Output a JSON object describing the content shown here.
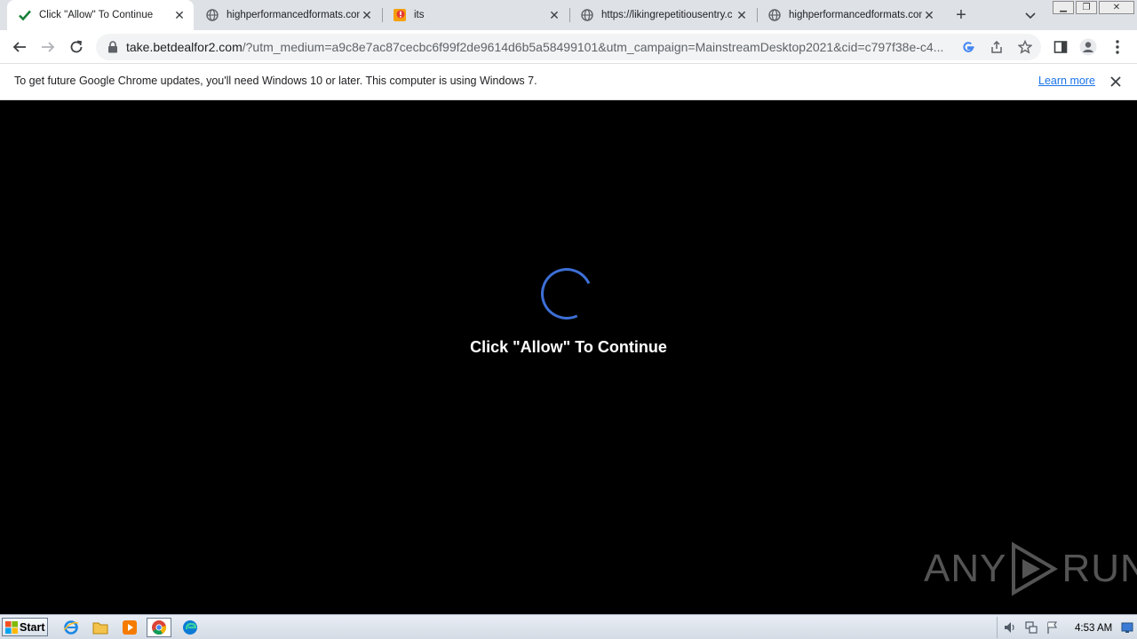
{
  "tabs": [
    {
      "title": "Click \"Allow\" To Continue",
      "icon": "checkmark-icon",
      "active": true
    },
    {
      "title": "highperformancedformats.com",
      "icon": "globe-icon"
    },
    {
      "title": "its",
      "icon": "app-icon"
    },
    {
      "title": "https://likingrepetitiousentry.c",
      "icon": "globe-icon"
    },
    {
      "title": "highperformancedformats.com",
      "icon": "globe-icon"
    }
  ],
  "omnibox": {
    "host": "take.betdealfor2.com",
    "path": "/?utm_medium=a9c8e7ac87cecbc6f99f2de9614d6b5a58499101&utm_campaign=MainstreamDesktop2021&cid=c797f38e-c4..."
  },
  "infobar": {
    "message": "To get future Google Chrome updates, you'll need Windows 10 or later. This computer is using Windows 7.",
    "link": "Learn more"
  },
  "page": {
    "headline": "Click \"Allow\" To Continue"
  },
  "watermark": {
    "left": "ANY",
    "right": "RUN"
  },
  "taskbar": {
    "start": "Start",
    "clock": "4:53 AM"
  },
  "colors": {
    "spinner": "#3d6fd6",
    "tab_check": "#188038",
    "link": "#1a73e8"
  }
}
